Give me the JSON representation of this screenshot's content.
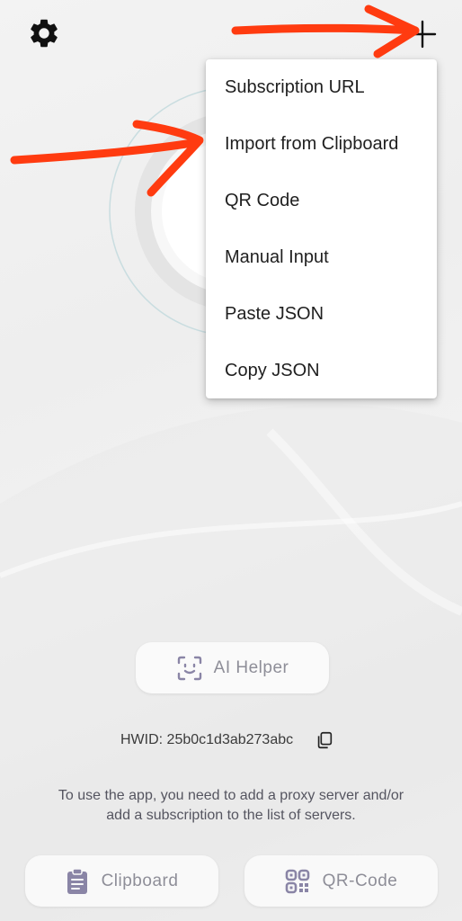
{
  "header": {
    "settings_icon": "gear-icon",
    "add_icon": "plus-icon"
  },
  "add_menu": {
    "items": [
      {
        "label": "Subscription URL"
      },
      {
        "label": "Import from Clipboard"
      },
      {
        "label": "QR Code"
      },
      {
        "label": "Manual Input"
      },
      {
        "label": "Paste JSON"
      },
      {
        "label": "Copy JSON"
      }
    ]
  },
  "ai_helper": {
    "label": "AI Helper",
    "icon": "face-scan-icon"
  },
  "hwid": {
    "text": "HWID: 25b0c1d3ab273abc",
    "icon": "copy-icon"
  },
  "hint": {
    "text": "To use the app, you need to add a proxy server and/or add a subscription to the list of servers."
  },
  "bottom": {
    "clipboard_label": "Clipboard",
    "clipboard_icon": "clipboard-icon",
    "qr_label": "QR-Code",
    "qr_icon": "qr-code-icon"
  },
  "colors": {
    "annotation_arrow": "#ff3b10",
    "button_text": "#8e8e98",
    "icon_purple": "#8a85a6"
  }
}
